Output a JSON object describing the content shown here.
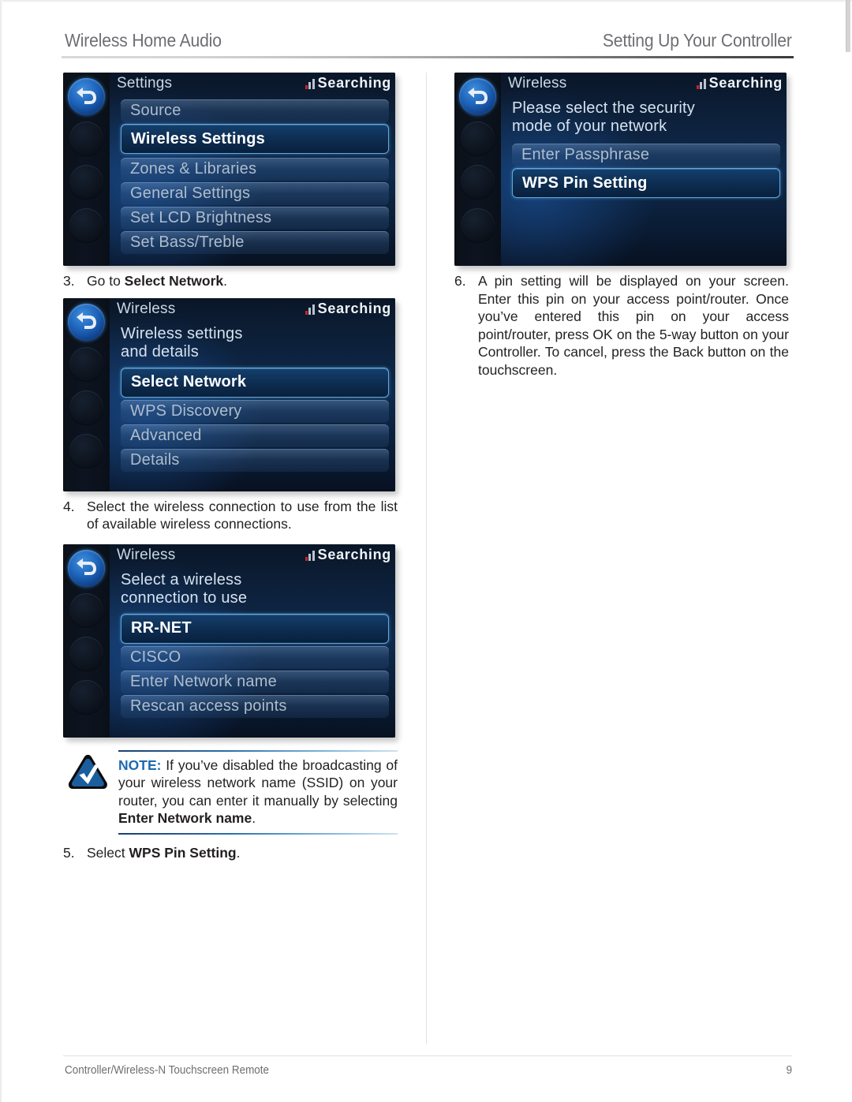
{
  "header": {
    "left_title": "Wireless Home Audio",
    "right_title": "Setting Up Your Controller"
  },
  "footer": {
    "left": "Controller/Wireless-N Touchscreen Remote",
    "page_number": "9"
  },
  "colors": {
    "note_label": "#1c6bb0",
    "lcd_selected_border": "#5fa9e0",
    "signal_first_bar": "#cf2127",
    "header_text": "#6e6e73"
  },
  "screens": {
    "settings": {
      "title": "Settings",
      "status_text": "Searching",
      "status_icon": "signal-bars-icon",
      "back_icon": "back-arrow-icon",
      "items": [
        {
          "label": "Source",
          "selected": false
        },
        {
          "label": "Wireless Settings",
          "selected": true
        },
        {
          "label": "Zones & Libraries",
          "selected": false
        },
        {
          "label": "General Settings",
          "selected": false
        },
        {
          "label": "Set LCD Brightness",
          "selected": false
        },
        {
          "label": "Set Bass/Treble",
          "selected": false
        }
      ]
    },
    "wireless_details": {
      "title": "Wireless",
      "status_text": "Searching",
      "prompt": "Wireless settings\nand details",
      "items": [
        {
          "label": "Select Network",
          "selected": true
        },
        {
          "label": "WPS Discovery",
          "selected": false
        },
        {
          "label": "Advanced",
          "selected": false
        },
        {
          "label": "Details",
          "selected": false
        }
      ]
    },
    "select_connection": {
      "title": "Wireless",
      "status_text": "Searching",
      "prompt": "Select a wireless\nconnection to use",
      "items": [
        {
          "label": "RR-NET",
          "selected": true
        },
        {
          "label": "CISCO",
          "selected": false
        },
        {
          "label": "Enter Network name",
          "selected": false
        },
        {
          "label": "Rescan access points",
          "selected": false
        }
      ]
    },
    "security_mode": {
      "title": "Wireless",
      "status_text": "Searching",
      "prompt": "Please select the security\nmode of your network",
      "items": [
        {
          "label": "Enter Passphrase",
          "selected": false
        },
        {
          "label": "WPS Pin Setting",
          "selected": true
        }
      ]
    }
  },
  "steps": {
    "step3": {
      "number": "3.",
      "text_before": "Go to ",
      "bold": "Select Network",
      "text_after": "."
    },
    "step4": {
      "number": "4.",
      "text": "Select the wireless connection to use from the list of available wireless connections."
    },
    "step5": {
      "number": "5.",
      "text_before": "Select ",
      "bold": "WPS Pin Setting",
      "text_after": "."
    },
    "step6": {
      "number": "6.",
      "text": "A pin setting will be displayed on your screen. Enter this pin on your access point/router. Once you’ve entered this pin on your access point/router, press OK on the 5-way button on your Controller. To cancel, press the Back button on the touchscreen."
    }
  },
  "note": {
    "icon": "check-triangle-icon",
    "label": "NOTE:",
    "text_before": " If you’ve disabled the broadcasting of your wireless network name (SSID) on your router, you can enter it manually by selecting ",
    "bold": "Enter Network name",
    "text_after": "."
  }
}
